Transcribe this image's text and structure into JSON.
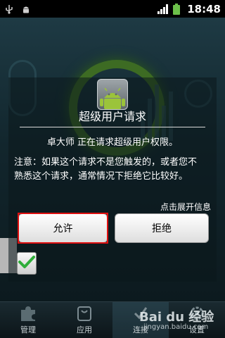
{
  "status_bar": {
    "time": "18:48",
    "icons": [
      "usb-icon",
      "android-icon",
      "signal-icon",
      "battery-icon"
    ],
    "battery_color": "#6cc04a"
  },
  "dialog": {
    "title": "超级用户请求",
    "message": "卓大师 正在请求超级用户权限。",
    "note_line1": "注意：如果这个请求不是您触发的，或者您不",
    "note_line2": "熟悉这个请求，通常情况下拒绝它比较好。",
    "expand_label": "点击展开信息",
    "allow_label": "允许",
    "deny_label": "拒绝",
    "highlight_color": "#e01010",
    "remember_checked": true
  },
  "bottom_nav": {
    "items": [
      {
        "label": "管理",
        "icon": "puzzle-icon"
      },
      {
        "label": "应用",
        "icon": "bag-icon"
      },
      {
        "label": "连接",
        "icon": "link-icon"
      },
      {
        "label": "设置",
        "icon": "gear-icon"
      }
    ]
  },
  "watermark": {
    "text": "Bai du 经验",
    "url": "jingyan.baidu.com"
  }
}
